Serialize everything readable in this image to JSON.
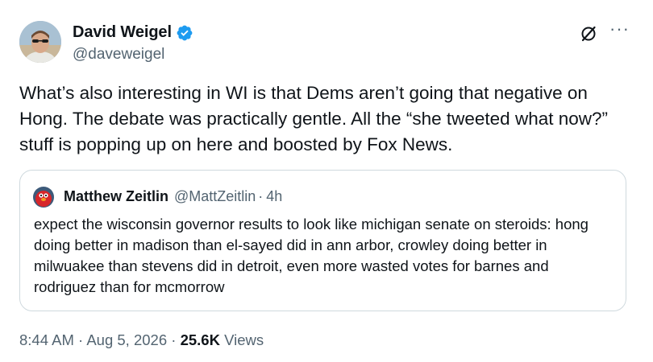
{
  "author": {
    "name": "David Weigel",
    "handle": "@daveweigel",
    "verified": true
  },
  "icons": {
    "verified": "verified-badge-icon",
    "grok": "grok-icon",
    "more": "more-options-icon"
  },
  "colors": {
    "verified_blue": "#1d9bf0",
    "secondary_text": "#536471",
    "border": "#cfd9de"
  },
  "tweet": {
    "text": "What’s also interesting in WI is that Dems aren’t going that negative on Hong. The debate was practically gentle. All the “she tweeted what now?” stuff is popping up on here and boosted by Fox News."
  },
  "quoted": {
    "name": "Matthew Zeitlin",
    "handle": "@MattZeitlin",
    "separator": "·",
    "time": "4h",
    "text": "expect the wisconsin governor results to look like michigan senate on steroids: hong doing better in madison than el-sayed did in ann arbor, crowley doing better in milwuakee than stevens did in detroit, even more wasted votes for barnes and rodriguez than for mcmorrow"
  },
  "footer": {
    "time": "8:44 AM",
    "sep1": "·",
    "date": "Aug 5, 2026",
    "sep2": "·",
    "views_count": "25.6K",
    "views_label": "Views"
  }
}
